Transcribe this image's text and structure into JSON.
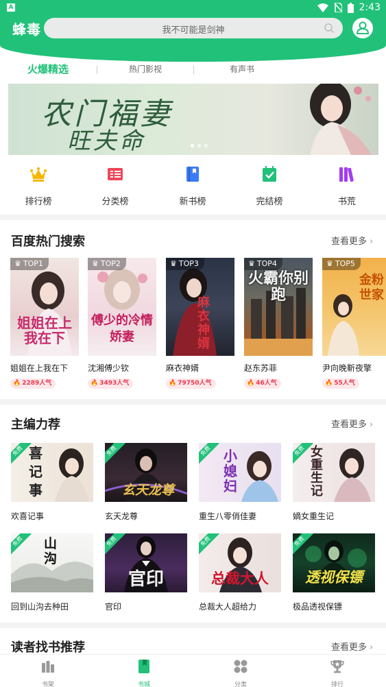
{
  "status_bar": {
    "time": "2:43"
  },
  "header": {
    "brand": "蜂毒",
    "search_placeholder": "我不可能是剑神"
  },
  "tabs": [
    {
      "label": "火爆精选",
      "active": true
    },
    {
      "label": "热门影视",
      "active": false
    },
    {
      "label": "有声书",
      "active": false
    }
  ],
  "banner": {
    "title_line1": "农门福妻",
    "title_line2": "旺夫命"
  },
  "categories": [
    {
      "label": "排行榜",
      "icon": "crown-icon",
      "color": "#f5b800"
    },
    {
      "label": "分类榜",
      "icon": "list-icon",
      "color": "#f0475a"
    },
    {
      "label": "新书榜",
      "icon": "book-icon",
      "color": "#3d7bf5"
    },
    {
      "label": "完结榜",
      "icon": "calendar-check-icon",
      "color": "#21c179"
    },
    {
      "label": "书荒",
      "icon": "books-icon",
      "color": "#a33df0"
    }
  ],
  "hot_search": {
    "title": "百度热门搜索",
    "more": "查看更多",
    "books": [
      {
        "rank": "TOP1",
        "name": "姐姐在上我在下",
        "popularity": "2289人气",
        "cover_text": "姐姐在上我在下"
      },
      {
        "rank": "TOP2",
        "name": "沈湘傅少钦",
        "popularity": "3493人气",
        "cover_text": "傅少的冷情娇妻"
      },
      {
        "rank": "TOP3",
        "name": "麻衣神婿",
        "popularity": "79750人气",
        "cover_text": "麻衣神婿"
      },
      {
        "rank": "TOP4",
        "name": "赵东苏菲",
        "popularity": "46人气",
        "cover_text": "火霸你别跑"
      },
      {
        "rank": "TOP5",
        "name": "尹向晚靳夜擎",
        "popularity": "55人气",
        "cover_text": "金粉世家"
      }
    ]
  },
  "editor_picks": {
    "title": "主编力荐",
    "more": "查看更多",
    "free_label": "免费",
    "books": [
      {
        "name": "欢喜记事",
        "cover_text": "喜记事"
      },
      {
        "name": "玄天龙尊",
        "cover_text": "玄天龙尊"
      },
      {
        "name": "重生八零俏佳妻",
        "cover_text": "小媳妇"
      },
      {
        "name": "嫡女重生记",
        "cover_text": "女重生记"
      },
      {
        "name": "回到山沟去种田",
        "cover_text": "山沟"
      },
      {
        "name": "官印",
        "cover_text": "官印"
      },
      {
        "name": "总裁大人超给力",
        "cover_text": "总裁大人"
      },
      {
        "name": "极品透视保镖",
        "cover_text": "透视保镖"
      }
    ]
  },
  "reader_recommend": {
    "title": "读者找书推荐",
    "more": "查看更多"
  },
  "bottom_nav": [
    {
      "label": "书架",
      "icon": "bookshelf-icon",
      "active": false
    },
    {
      "label": "书城",
      "icon": "bookstore-icon",
      "active": true
    },
    {
      "label": "分类",
      "icon": "category-icon",
      "active": false
    },
    {
      "label": "排行",
      "icon": "trophy-icon",
      "active": false
    }
  ],
  "colors": {
    "accent": "#21c179",
    "hot_red": "#e8394f"
  }
}
